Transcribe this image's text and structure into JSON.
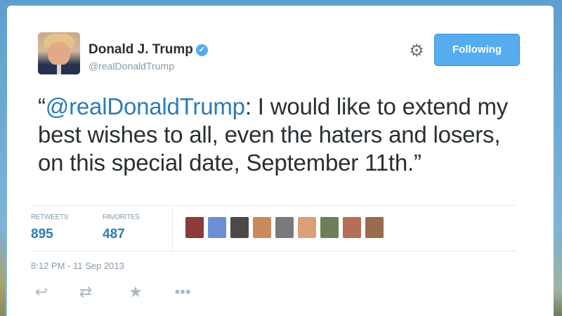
{
  "user": {
    "display_name": "Donald J. Trump",
    "handle": "@realDonaldTrump",
    "verified": true,
    "avatar_icon": "profile-photo"
  },
  "header": {
    "settings_icon": "gear-icon",
    "follow_button_label": "Following",
    "accent_color": "#55acee"
  },
  "tweet": {
    "open_quote": "“",
    "mention": "@realDonaldTrump",
    "text_after_mention": ": I would like to extend my best wishes to all, even the haters and losers, on this special date, September 11th.”",
    "timestamp": "8:12 PM - 11 Sep 2013"
  },
  "stats": {
    "retweets_label": "RETWEETS",
    "retweets_value": "895",
    "favorites_label": "FAVORITES",
    "favorites_value": "487"
  },
  "favoriters": [
    {
      "name": "favoriter-avatar",
      "color": "#8a3b3b"
    },
    {
      "name": "favoriter-avatar",
      "color": "#6b8fd6"
    },
    {
      "name": "favoriter-avatar",
      "color": "#4a4a4a"
    },
    {
      "name": "favoriter-avatar",
      "color": "#c98a5e"
    },
    {
      "name": "favoriter-avatar",
      "color": "#7a7a7a"
    },
    {
      "name": "favoriter-avatar",
      "color": "#d9a07a"
    },
    {
      "name": "favoriter-avatar",
      "color": "#6f7d5a"
    },
    {
      "name": "favoriter-avatar",
      "color": "#b56e58"
    },
    {
      "name": "favoriter-avatar",
      "color": "#9a6b4e"
    }
  ],
  "actions": {
    "reply_icon": "reply-icon",
    "retweet_icon": "retweet-icon",
    "favorite_icon": "star-icon",
    "more_icon": "more-icon"
  }
}
